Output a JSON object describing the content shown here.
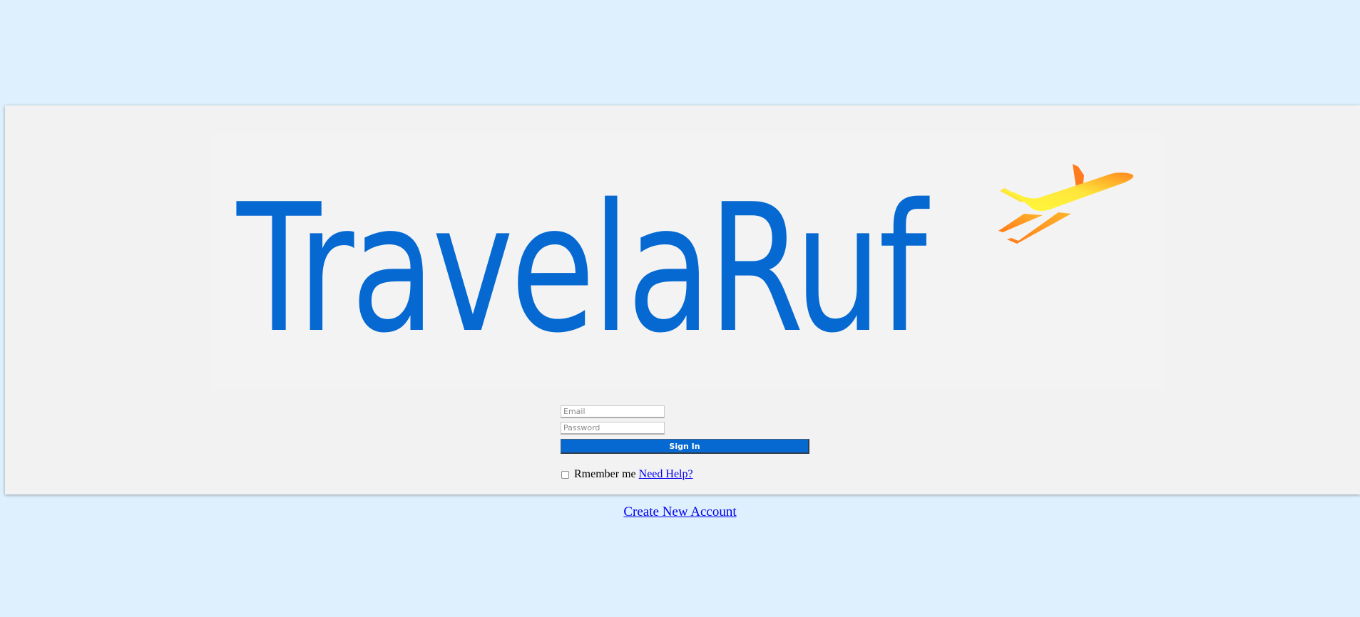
{
  "logo": {
    "text": "TravelaRuf",
    "brand_color": "#0569d1",
    "plane_icon": "airplane-icon"
  },
  "login_form": {
    "email_placeholder": "Email",
    "email_value": "",
    "password_placeholder": "Password",
    "password_value": "",
    "sign_in_label": "Sign In",
    "remember_label": "Rmember me",
    "remember_checked": false,
    "need_help_label": "Need Help?"
  },
  "footer": {
    "create_account_label": "Create New Account"
  },
  "colors": {
    "page_background": "#def0fd",
    "card_background": "#f2f2f2",
    "link": "#0000ee"
  }
}
